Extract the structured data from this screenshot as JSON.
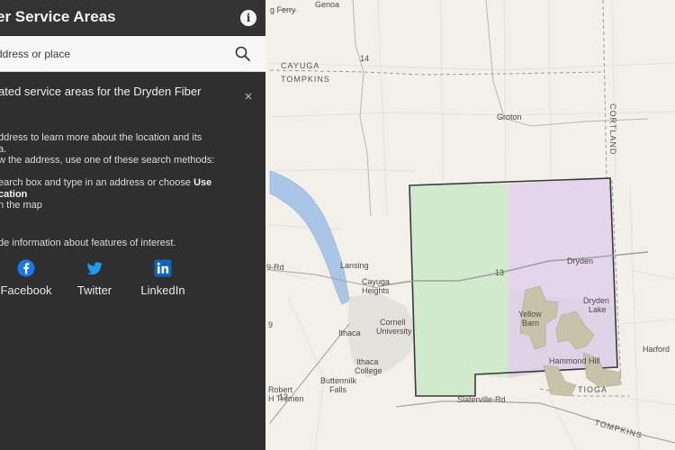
{
  "app": {
    "title": "er Service Areas",
    "info_label": "i"
  },
  "search": {
    "placeholder": "ddress or place"
  },
  "panel": {
    "intro_title": "ated service areas for the Dryden Fiber\n",
    "desc_lines": [
      "ddress to learn more about the location and its",
      "a.",
      "w the address, use one of these search methods:",
      "",
      "earch box and type in an address or choose ",
      "cation",
      "n the map"
    ],
    "use_label": "Use",
    "features_line": "de information about features of interest.",
    "share": [
      {
        "label": "Facebook",
        "icon": "facebook-icon",
        "color": "#1877f2"
      },
      {
        "label": "Twitter",
        "icon": "twitter-icon",
        "color": "#1d9bf0"
      },
      {
        "label": "LinkedIn",
        "icon": "linkedin-icon",
        "color": "#0a66c2"
      }
    ]
  },
  "map": {
    "places": [
      {
        "name": "g Ferry"
      },
      {
        "name": "Genoa"
      },
      {
        "name": "Groton"
      },
      {
        "name": "Dryden"
      },
      {
        "name": "Dryden"
      },
      {
        "name": "Lake"
      },
      {
        "name": "Lansing"
      },
      {
        "name": "Cayuga"
      },
      {
        "name": "Heights"
      },
      {
        "name": "Cornell"
      },
      {
        "name": "University"
      },
      {
        "name": "Ithaca"
      },
      {
        "name": "Ithaca"
      },
      {
        "name": "College"
      },
      {
        "name": "Yellow"
      },
      {
        "name": "Barn"
      },
      {
        "name": "Hammond Hill"
      },
      {
        "name": "Harford"
      },
      {
        "name": "Buttermilk"
      },
      {
        "name": "Falls"
      },
      {
        "name": "Robert"
      },
      {
        "name": "H Tremen"
      },
      {
        "name": "Slaterville-Rd"
      },
      {
        "name": "9-Rd"
      },
      {
        "name": "13"
      },
      {
        "name": "13"
      },
      {
        "name": "9"
      },
      {
        "name": "14"
      }
    ],
    "regions": [
      {
        "name": "CAYUGA"
      },
      {
        "name": "TOMPKINS"
      },
      {
        "name": "CORTLAND"
      },
      {
        "name": "TIOGA"
      },
      {
        "name": "TOMPKINS"
      }
    ],
    "colors": {
      "lake": "#a9c6e6",
      "service_green": "#cde9c9",
      "service_purple": "#e3d2ec",
      "boundary": "#3a3a3a"
    }
  }
}
